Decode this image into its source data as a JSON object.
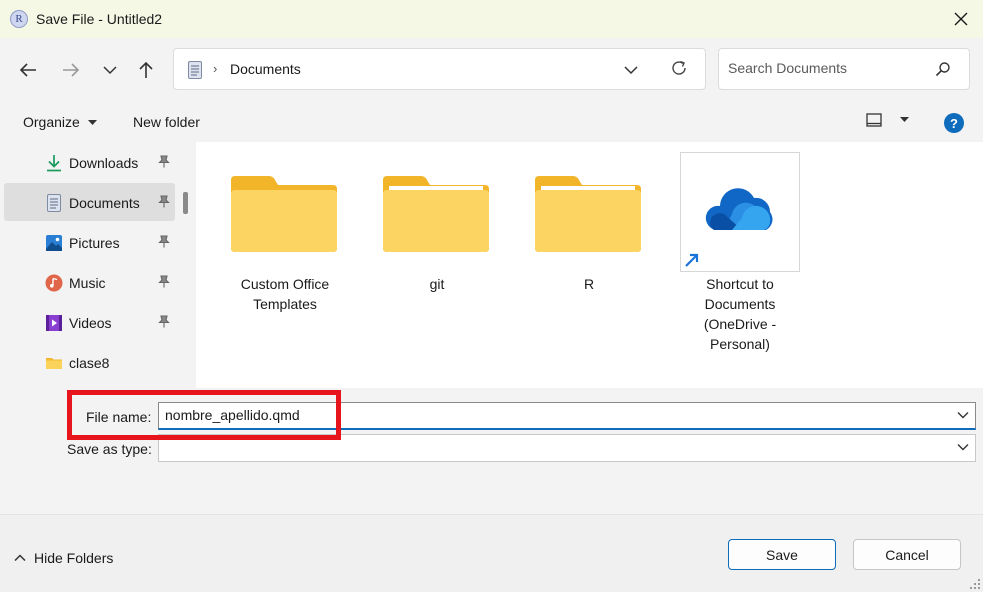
{
  "window": {
    "app_icon_letter": "R",
    "title": "Save File - Untitled2"
  },
  "address_bar": {
    "separator": "›",
    "crumb": "Documents"
  },
  "search": {
    "placeholder": "Search Documents"
  },
  "commands": {
    "organize": "Organize",
    "new_folder": "New folder",
    "help": "?"
  },
  "sidebar": {
    "items": [
      {
        "label": "Downloads",
        "icon": "download-icon",
        "pinned": true
      },
      {
        "label": "Documents",
        "icon": "documents-icon",
        "pinned": true,
        "selected": true
      },
      {
        "label": "Pictures",
        "icon": "pictures-icon",
        "pinned": true
      },
      {
        "label": "Music",
        "icon": "music-icon",
        "pinned": true
      },
      {
        "label": "Videos",
        "icon": "videos-icon",
        "pinned": true
      },
      {
        "label": "clase8",
        "icon": "folder-icon",
        "pinned": false
      }
    ]
  },
  "files": [
    {
      "name": "Custom Office Templates",
      "type": "folder"
    },
    {
      "name": "git",
      "type": "folder"
    },
    {
      "name": "R",
      "type": "folder"
    },
    {
      "name": "Shortcut to Documents (OneDrive - Personal)",
      "type": "shortcut"
    }
  ],
  "form": {
    "file_name_label": "File name:",
    "file_name_value": "nombre_apellido.qmd",
    "save_type_label": "Save as type:",
    "save_type_value": ""
  },
  "footer": {
    "hide_folders": "Hide Folders",
    "save": "Save",
    "cancel": "Cancel"
  },
  "colors": {
    "accent": "#0f6cbd",
    "highlight": "#e8141b",
    "folder": "#f8c842"
  }
}
